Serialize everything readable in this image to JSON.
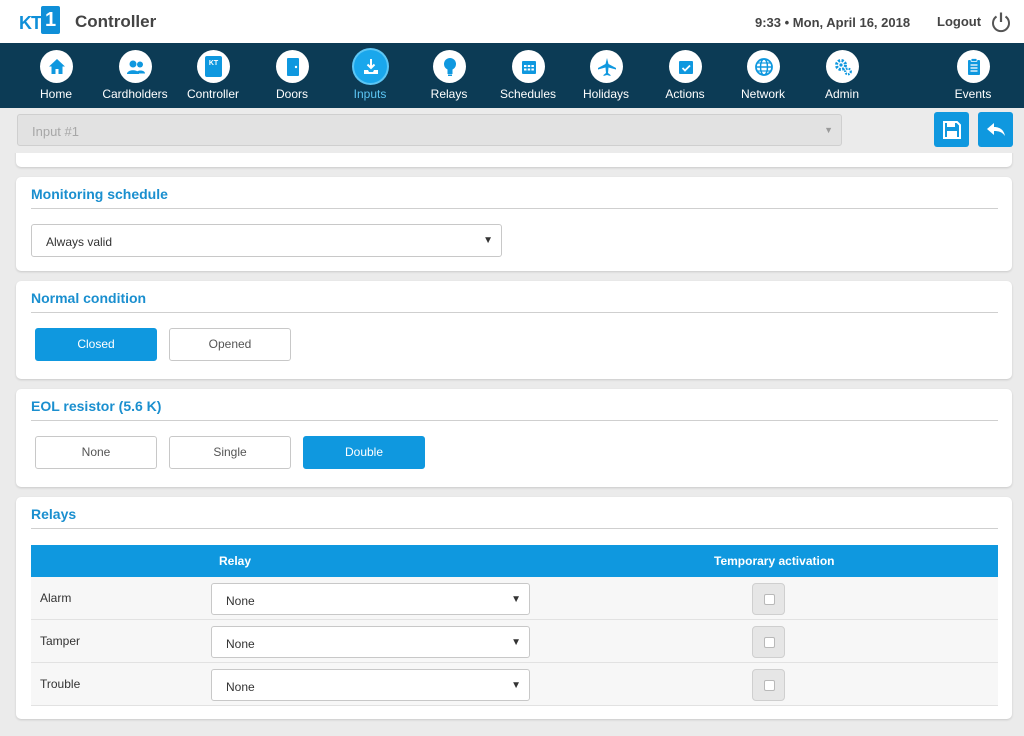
{
  "header": {
    "logo_text": "KT",
    "logo_number": "1",
    "app_title": "Controller",
    "datetime": "9:33 • Mon, April 16, 2018",
    "logout_label": "Logout"
  },
  "nav": {
    "items": [
      {
        "label": "Home",
        "icon": "home-icon"
      },
      {
        "label": "Cardholders",
        "icon": "users-icon"
      },
      {
        "label": "Controller",
        "icon": "controller-icon"
      },
      {
        "label": "Doors",
        "icon": "door-icon"
      },
      {
        "label": "Inputs",
        "icon": "input-icon"
      },
      {
        "label": "Relays",
        "icon": "lightbulb-icon"
      },
      {
        "label": "Schedules",
        "icon": "calendar-icon"
      },
      {
        "label": "Holidays",
        "icon": "airplane-icon"
      },
      {
        "label": "Actions",
        "icon": "calendar-check-icon"
      },
      {
        "label": "Network",
        "icon": "globe-icon"
      },
      {
        "label": "Admin",
        "icon": "gears-icon"
      },
      {
        "label": "Events",
        "icon": "clipboard-icon"
      }
    ],
    "active": "Inputs",
    "controller_badge": "KT"
  },
  "subbar": {
    "selected_input": "Input #1"
  },
  "monitoring": {
    "title": "Monitoring schedule",
    "value": "Always valid"
  },
  "normal_condition": {
    "title": "Normal condition",
    "options": [
      "Closed",
      "Opened"
    ],
    "selected": "Closed"
  },
  "eol": {
    "title": "EOL resistor (5.6 K)",
    "options": [
      "None",
      "Single",
      "Double"
    ],
    "selected": "Double"
  },
  "relays": {
    "title": "Relays",
    "columns": [
      "Relay",
      "Temporary activation"
    ],
    "rows": [
      {
        "name": "Alarm",
        "relay": "None",
        "temporary": false
      },
      {
        "name": "Tamper",
        "relay": "None",
        "temporary": false
      },
      {
        "name": "Trouble",
        "relay": "None",
        "temporary": false
      }
    ]
  },
  "colors": {
    "nav_background": "#0c3b55",
    "accent": "#0f98df",
    "title_blue": "#1a8fcf"
  }
}
